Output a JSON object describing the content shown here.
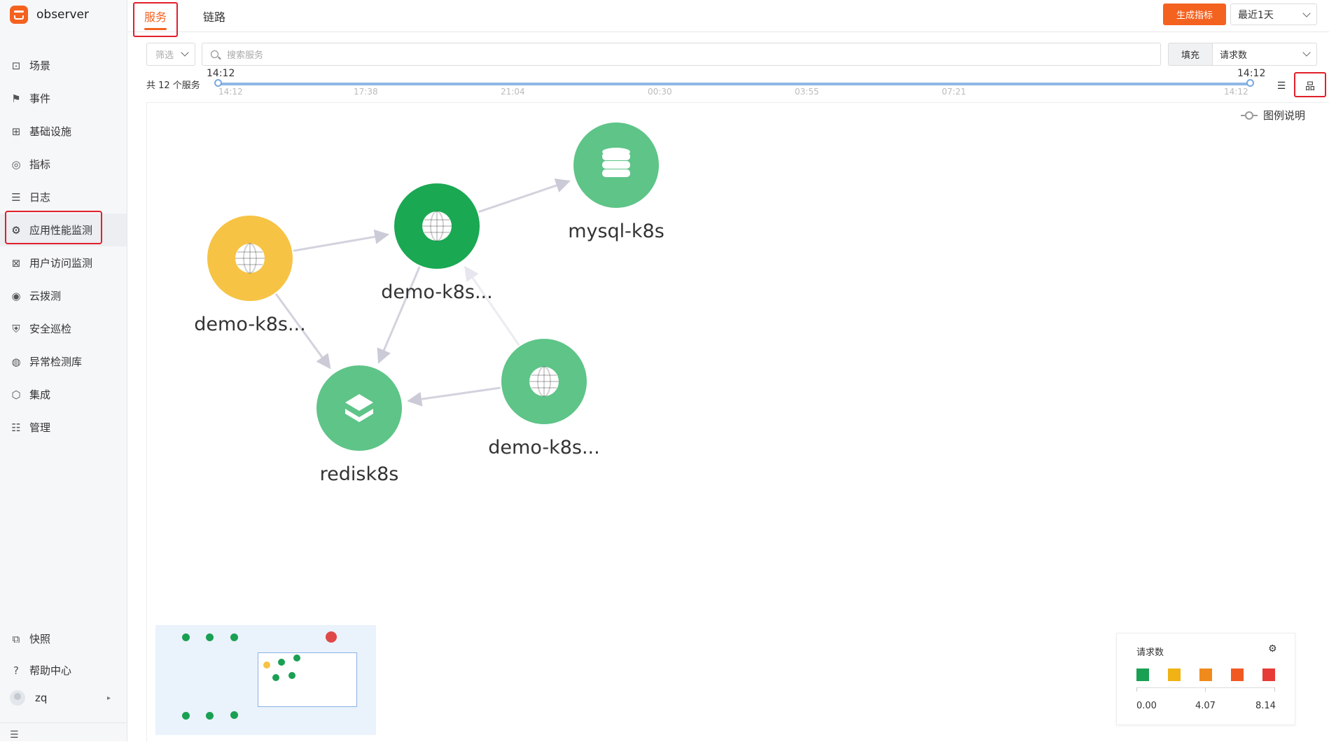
{
  "app": {
    "name": "observer"
  },
  "sidebar": {
    "items": [
      {
        "label": "场景",
        "icon": "dashboard-icon",
        "glyph": "⊡"
      },
      {
        "label": "事件",
        "icon": "flag-icon",
        "glyph": "⚑"
      },
      {
        "label": "基础设施",
        "icon": "grid-icon",
        "glyph": "⊞"
      },
      {
        "label": "指标",
        "icon": "gauge-icon",
        "glyph": "◎"
      },
      {
        "label": "日志",
        "icon": "log-icon",
        "glyph": "☰"
      },
      {
        "label": "应用性能监测",
        "icon": "apm-icon",
        "glyph": "⚙"
      },
      {
        "label": "用户访问监测",
        "icon": "rum-icon",
        "glyph": "⊠"
      },
      {
        "label": "云拨测",
        "icon": "signal-icon",
        "glyph": "◉"
      },
      {
        "label": "安全巡检",
        "icon": "shield-icon",
        "glyph": "⛨"
      },
      {
        "label": "异常检测库",
        "icon": "anomaly-icon",
        "glyph": "◍"
      },
      {
        "label": "集成",
        "icon": "cube-icon",
        "glyph": "⬡"
      },
      {
        "label": "管理",
        "icon": "settings-sliders-icon",
        "glyph": "☷"
      }
    ],
    "bottom_items": [
      {
        "label": "快照",
        "icon": "snapshot-icon",
        "glyph": "⧉"
      },
      {
        "label": "帮助中心",
        "icon": "help-icon",
        "glyph": "?"
      }
    ],
    "user": "zq"
  },
  "header": {
    "tabs": [
      {
        "label": "服务",
        "active": true
      },
      {
        "label": "链路",
        "active": false
      }
    ],
    "generate_button": "生成指标",
    "time_range": "最近1天"
  },
  "filters": {
    "filter_select": "筛选",
    "search_placeholder": "搜索服务",
    "fill_label": "填充",
    "metric_select": "请求数"
  },
  "timeline": {
    "count_label": "共 12 个服务",
    "start_label": "14:12",
    "end_label": "14:12",
    "ticks": [
      "14:12",
      "17:38",
      "21:04",
      "00:30",
      "03:55",
      "07:21",
      "14:12"
    ]
  },
  "graph": {
    "legend_link": "图例说明",
    "nodes": [
      {
        "id": "n1",
        "label": "demo-k8s...",
        "kind": "web",
        "color": "#f6c344"
      },
      {
        "id": "n2",
        "label": "demo-k8s...",
        "kind": "web",
        "color": "#1aa853"
      },
      {
        "id": "n3",
        "label": "mysql-k8s",
        "kind": "database",
        "color": "#5ec488"
      },
      {
        "id": "n4",
        "label": "redisk8s",
        "kind": "cache",
        "color": "#5ec488"
      },
      {
        "id": "n5",
        "label": "demo-k8s...",
        "kind": "web",
        "color": "#5ec488"
      }
    ],
    "edges": [
      {
        "from": "n1",
        "to": "n2"
      },
      {
        "from": "n2",
        "to": "n3"
      },
      {
        "from": "n1",
        "to": "n4"
      },
      {
        "from": "n2",
        "to": "n4"
      },
      {
        "from": "n5",
        "to": "n4"
      },
      {
        "from": "n5",
        "to": "n2"
      }
    ]
  },
  "color_legend": {
    "title": "请求数",
    "colors": [
      "#1aa053",
      "#f0b214",
      "#f08a1c",
      "#f05a22",
      "#e63b36"
    ],
    "values": [
      "0.00",
      "4.07",
      "8.14"
    ]
  },
  "minimap": {
    "dot_color": "#1aa053",
    "accent_dot_color": "#e04848",
    "yellow_dot_color": "#f6c344"
  }
}
